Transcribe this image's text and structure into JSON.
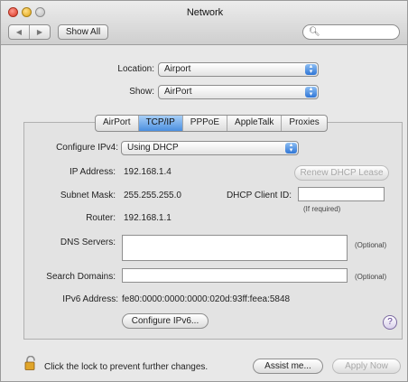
{
  "window": {
    "title": "Network"
  },
  "toolbar": {
    "back_glyph": "◀",
    "forward_glyph": "▶",
    "show_all_label": "Show All",
    "search_value": "",
    "search_icon": "search-icon"
  },
  "location": {
    "label": "Location:",
    "value": "Airport"
  },
  "show": {
    "label": "Show:",
    "value": "AirPort"
  },
  "tabs": [
    {
      "label": "AirPort",
      "active": false
    },
    {
      "label": "TCP/IP",
      "active": true
    },
    {
      "label": "PPPoE",
      "active": false
    },
    {
      "label": "AppleTalk",
      "active": false
    },
    {
      "label": "Proxies",
      "active": false
    }
  ],
  "tcpip": {
    "configure_label": "Configure IPv4:",
    "configure_value": "Using DHCP",
    "ip_label": "IP Address:",
    "ip_value": "192.168.1.4",
    "renew_label": "Renew DHCP Lease",
    "subnet_label": "Subnet Mask:",
    "subnet_value": "255.255.255.0",
    "client_id_label": "DHCP Client ID:",
    "client_id_value": "",
    "client_id_hint": "(If required)",
    "router_label": "Router:",
    "router_value": "192.168.1.1",
    "dns_label": "DNS Servers:",
    "dns_value": "",
    "dns_optional": "(Optional)",
    "search_domains_label": "Search Domains:",
    "search_domains_value": "",
    "search_domains_optional": "(Optional)",
    "ipv6_label": "IPv6 Address:",
    "ipv6_value": "fe80:0000:0000:0000:020d:93ff:feea:5848",
    "configure_ipv6_label": "Configure IPv6...",
    "help_label": "?"
  },
  "footer": {
    "lock_text": "Click the lock to prevent further changes.",
    "assist_label": "Assist me...",
    "apply_label": "Apply Now"
  }
}
